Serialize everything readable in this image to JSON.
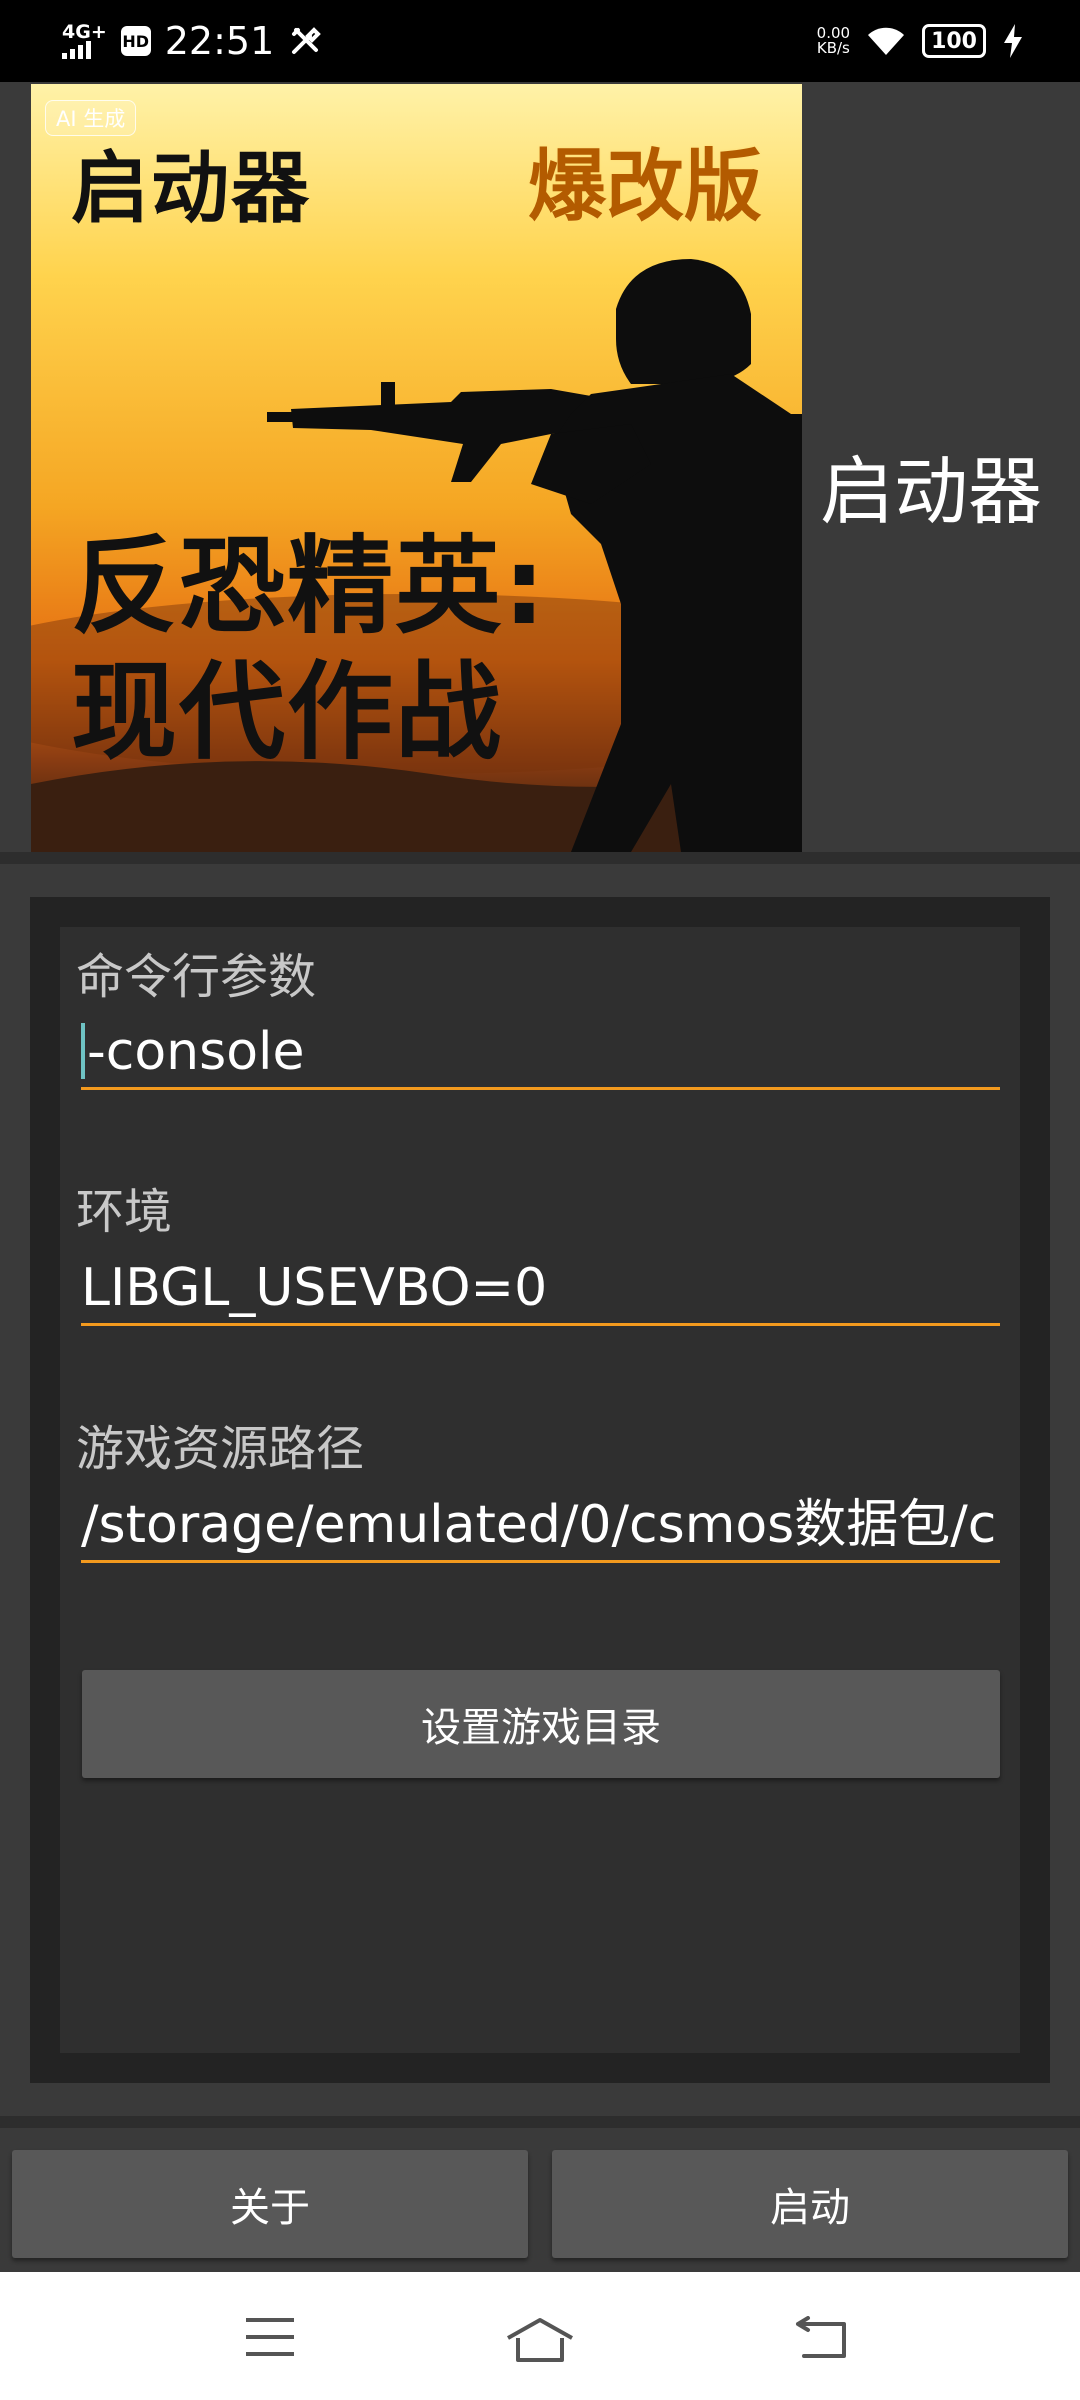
{
  "status_bar": {
    "network": "4G+",
    "hd": "HD",
    "time": "22:51",
    "speed_value": "0.00",
    "speed_unit": "KB/s",
    "battery": "100"
  },
  "banner": {
    "ai_badge": "AI 生成",
    "title_left": "启动器",
    "title_right": "爆改版",
    "game_title_line1": "反恐精英:",
    "game_title_line2": "现代作战"
  },
  "app_title": "启动器",
  "form": {
    "args_label": "命令行参数",
    "args_value": "-console",
    "env_label": "环境",
    "env_value": "LIBGL_USEVBO=0",
    "path_label": "游戏资源路径",
    "path_value": "/storage/emulated/0/csmos数据包/c",
    "set_dir_button": "设置游戏目录"
  },
  "bottom": {
    "about_button": "关于",
    "launch_button": "启动"
  },
  "icons": {
    "menu": "menu-icon",
    "home": "home-icon",
    "back": "back-icon"
  },
  "colors": {
    "accent_underline": "#f39a1e",
    "button_bg": "#585858",
    "background": "#3a3a3a"
  }
}
